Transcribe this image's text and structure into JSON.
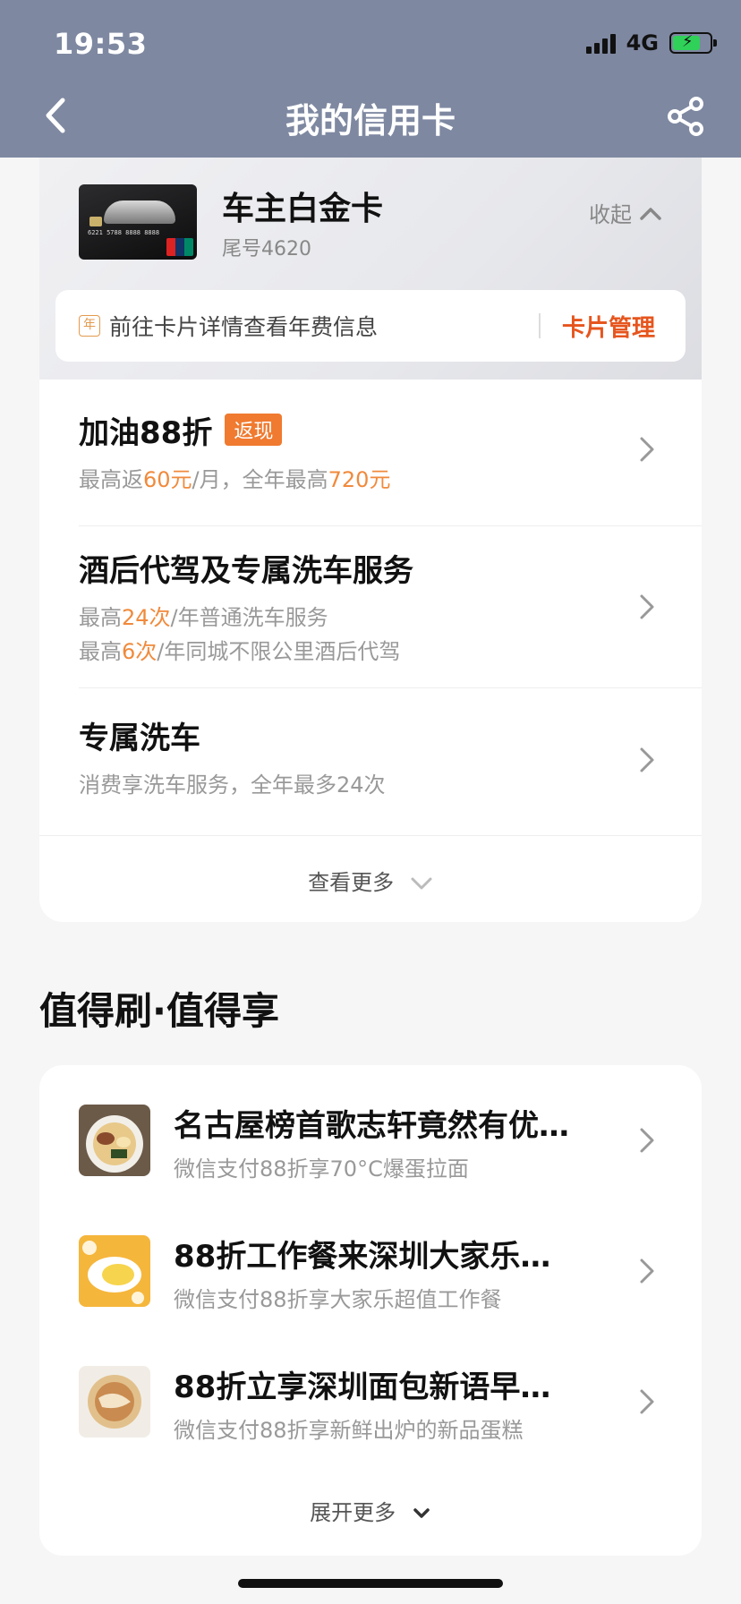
{
  "status_bar": {
    "time": "19:53",
    "network": "4G"
  },
  "nav": {
    "title": "我的信用卡"
  },
  "card": {
    "name": "车主白金卡",
    "tail": "尾号4620",
    "collapse_label": "收起",
    "thumb_number": "6221 5788 8888 8888",
    "annual_icon": "年",
    "annual_text": "前往卡片详情查看年费信息",
    "manage_label": "卡片管理"
  },
  "benefits": [
    {
      "title": "加油88折",
      "tag": "返现",
      "line1": {
        "a": "最高返",
        "b": "60元",
        "c": "/月，全年最高",
        "d": "720元"
      }
    },
    {
      "title": "酒后代驾及专属洗车服务",
      "line1": {
        "a": "最高",
        "b": "24次",
        "c": "/年普通洗车服务"
      },
      "line2": {
        "a": "最高",
        "b": "6次",
        "c": "/年同城不限公里酒后代驾"
      }
    },
    {
      "title": "专属洗车",
      "sub": "消费享洗车服务，全年最多24次"
    }
  ],
  "see_more": "查看更多",
  "section": {
    "title": "值得刷·值得享"
  },
  "offers": [
    {
      "title": "名古屋榜首歌志轩竟然有优…",
      "sub": "微信支付88折享70°C爆蛋拉面"
    },
    {
      "title": "88折工作餐来深圳大家乐…",
      "sub": "微信支付88折享大家乐超值工作餐"
    },
    {
      "title": "88折立享深圳面包新语早…",
      "sub": "微信支付88折享新鲜出炉的新品蛋糕"
    }
  ],
  "expand_more": "展开更多",
  "colors": {
    "header": "#7e88a1",
    "accent": "#e6551d",
    "highlight": "#f08a3c"
  },
  "icons": [
    "back-arrow-icon",
    "share-icon",
    "chevron-up-icon",
    "chevron-right-icon",
    "chevron-down-icon"
  ]
}
